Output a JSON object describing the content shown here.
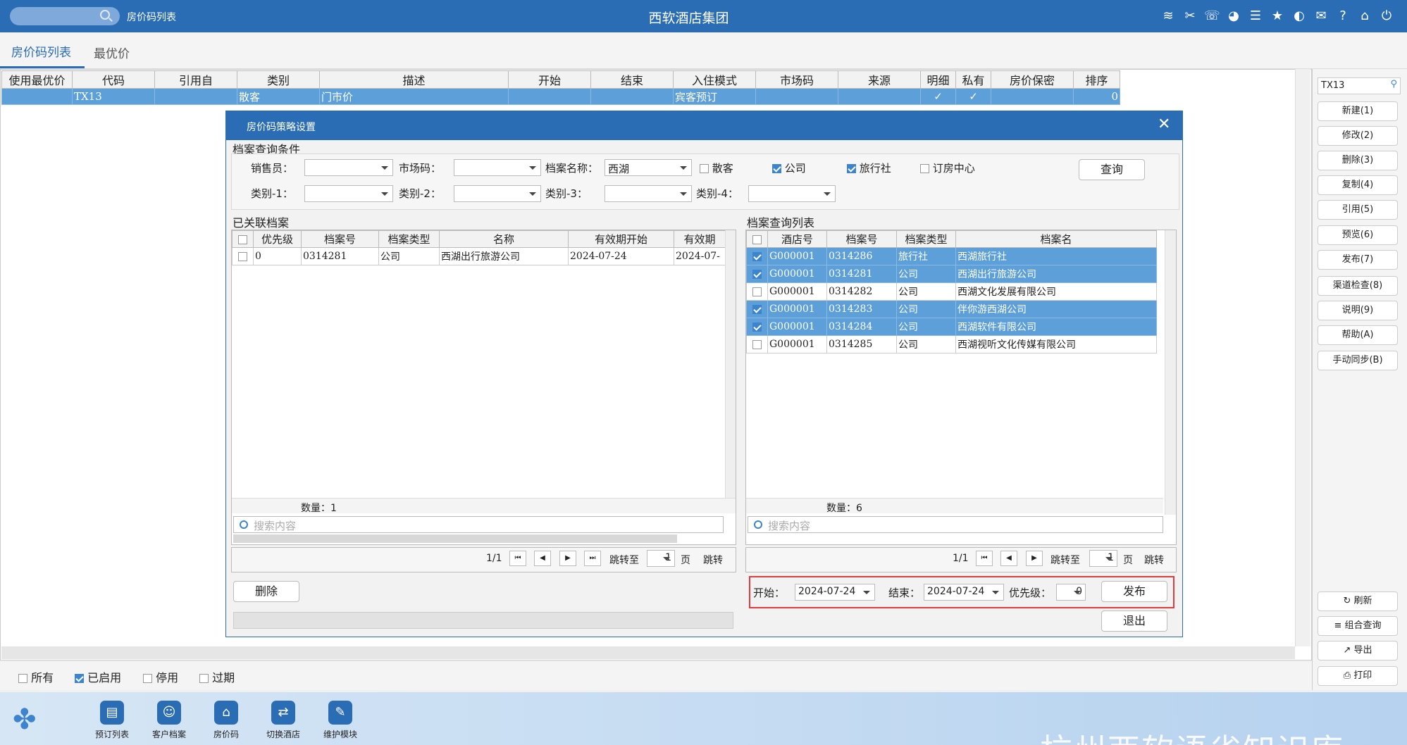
{
  "topbar": {
    "window_title": "房价码列表",
    "app_title": "西软酒店集团",
    "icons": [
      "wifi-icon",
      "tools-icon",
      "phone-icon",
      "palette-icon",
      "menu-icon",
      "star-icon",
      "theme-icon",
      "mail-icon",
      "help-icon",
      "home-icon",
      "power-icon"
    ]
  },
  "tabs": {
    "active": "房价码列表",
    "other": "最优价"
  },
  "main_table": {
    "headers": [
      "使用最优价",
      "代码",
      "引用自",
      "类别",
      "描述",
      "开始",
      "结束",
      "入住模式",
      "市场码",
      "来源",
      "明细",
      "私有",
      "房价保密",
      "排序"
    ],
    "row": {
      "use_best": "",
      "code": "TX13",
      "ref": "",
      "category": "散客",
      "desc": "门市价",
      "start": "",
      "end": "",
      "mode": "宾客预订",
      "market": "",
      "source": "",
      "detail": "✓",
      "private": "✓",
      "secret": "",
      "order": "0"
    }
  },
  "status_filters": [
    {
      "label": "所有",
      "checked": false
    },
    {
      "label": "已启用",
      "checked": true
    },
    {
      "label": "停用",
      "checked": false
    },
    {
      "label": "过期",
      "checked": false
    }
  ],
  "right_panel": {
    "search_value": "TX13",
    "buttons": [
      "新建(1)",
      "修改(2)",
      "删除(3)",
      "复制(4)",
      "引用(5)",
      "预览(6)",
      "发布(7)",
      "渠道检查(8)",
      "说明(9)",
      "帮助(A)",
      "手动同步(B)"
    ],
    "bottom_buttons": [
      "刷新",
      "组合查询",
      "导出",
      "打印"
    ]
  },
  "taskbar": {
    "items": [
      "预订列表",
      "客户档案",
      "房价码",
      "切换酒店",
      "维护模块"
    ],
    "watermark": "杭州西软语雀知识库"
  },
  "dialog": {
    "title": "房价码策略设置",
    "query_section": "档案查询条件",
    "labels": {
      "sales": "销售员：",
      "market": "市场码：",
      "name": "档案名称：",
      "cat1": "类别-1：",
      "cat2": "类别-2：",
      "cat3": "类别-3：",
      "cat4": "类别-4："
    },
    "name_value": "西湖",
    "type_checks": [
      {
        "label": "散客",
        "checked": false
      },
      {
        "label": "公司",
        "checked": true
      },
      {
        "label": "旅行社",
        "checked": true
      },
      {
        "label": "订房中心",
        "checked": false
      }
    ],
    "query_button": "查询",
    "linked": {
      "title": "已关联档案",
      "headers": [
        "优先级",
        "档案号",
        "档案类型",
        "名称",
        "有效期开始",
        "有效期"
      ],
      "rows": [
        {
          "priority": "0",
          "no": "0314281",
          "type": "公司",
          "name": "西湖出行旅游公司",
          "start": "2024-07-24",
          "end": "2024-07-"
        }
      ],
      "count": "数量：1",
      "search_placeholder": "搜索内容",
      "page": "1/1",
      "jump_label": "跳转至",
      "jump_value": "1",
      "page_unit": "页",
      "jump_button": "跳转"
    },
    "results": {
      "title": "档案查询列表",
      "headers": [
        "酒店号",
        "档案号",
        "档案类型",
        "档案名"
      ],
      "rows": [
        {
          "hotel": "G000001",
          "no": "0314286",
          "type": "旅行社",
          "name": "西湖旅行社",
          "checked": true
        },
        {
          "hotel": "G000001",
          "no": "0314281",
          "type": "公司",
          "name": "西湖出行旅游公司",
          "checked": true
        },
        {
          "hotel": "G000001",
          "no": "0314282",
          "type": "公司",
          "name": "西湖文化发展有限公司",
          "checked": false
        },
        {
          "hotel": "G000001",
          "no": "0314283",
          "type": "公司",
          "name": "伴你游西湖公司",
          "checked": true
        },
        {
          "hotel": "G000001",
          "no": "0314284",
          "type": "公司",
          "name": "西湖软件有限公司",
          "checked": true
        },
        {
          "hotel": "G000001",
          "no": "0314285",
          "type": "公司",
          "name": "西湖视听文化传媒有限公司",
          "checked": false
        }
      ],
      "count": "数量：6",
      "search_placeholder": "搜索内容",
      "page": "1/1",
      "jump_label": "跳转至",
      "jump_value": "1",
      "page_unit": "页",
      "jump_button": "跳转"
    },
    "delete_button": "删除",
    "publish": {
      "start_label": "开始：",
      "start_value": "2024-07-24",
      "end_label": "结束：",
      "end_value": "2024-07-24",
      "priority_label": "优先级：",
      "priority_value": "0",
      "publish_button": "发布"
    },
    "exit_button": "退出"
  }
}
